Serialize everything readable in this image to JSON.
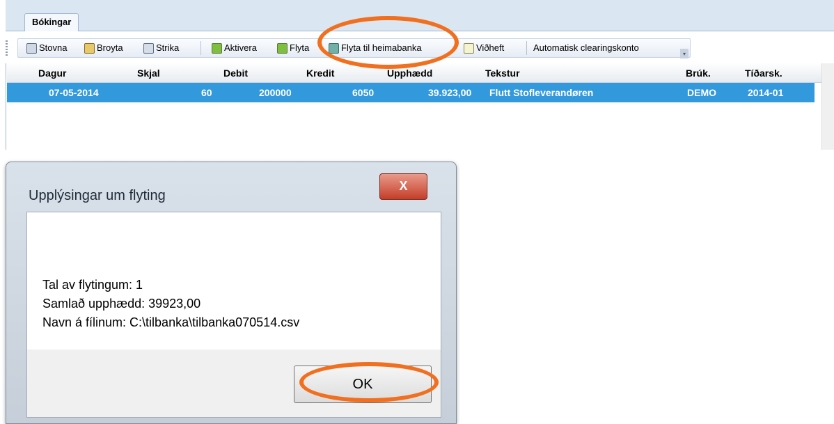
{
  "tab": {
    "label": "Bókingar"
  },
  "toolbar": {
    "stovna": "Stovna",
    "broyta": "Broyta",
    "strika": "Strika",
    "aktivera": "Aktivera",
    "flyta": "Flyta",
    "flyta_heimabanka": "Flyta til heimabanka",
    "vidheft": "Viðheft",
    "clearing": "Automatisk clearingskonto"
  },
  "grid": {
    "headers": {
      "dagur": "Dagur",
      "skjal": "Skjal",
      "debit": "Debit",
      "kredit": "Kredit",
      "upphaedd": "Upphædd",
      "tekstur": "Tekstur",
      "bruk": "Brúk.",
      "tidarsk": "Tíðarsk."
    },
    "row": {
      "dagur": "07-05-2014",
      "skjal": "60",
      "debit": "200000",
      "kredit": "6050",
      "upphaedd": "39.923,00",
      "tekstur": "Flutt Stofleverandøren",
      "bruk": "DEMO",
      "tidarsk": "2014-01"
    }
  },
  "dialog": {
    "title": "Upplýsingar um flyting",
    "close": "X",
    "line1": "Tal av flytingum: 1",
    "line2": "Samlað upphædd: 39923,00",
    "line3": "Navn á fílinum: C:\\tilbanka\\tilbanka070514.csv",
    "ok": "OK"
  },
  "colors": {
    "selection": "#3399dd",
    "highlight": "#f07020"
  }
}
